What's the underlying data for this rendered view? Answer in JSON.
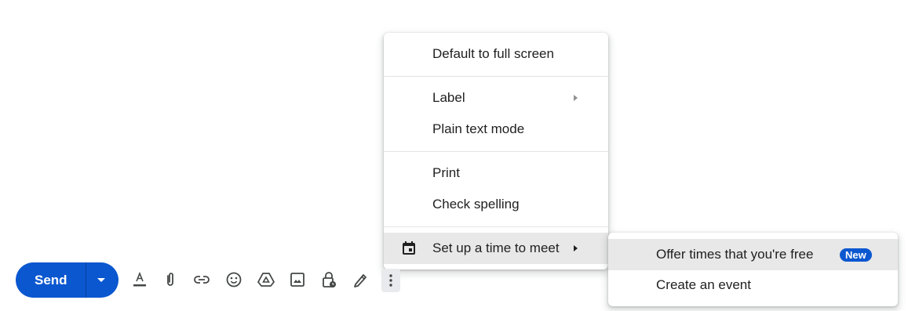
{
  "main_menu": {
    "items": [
      {
        "label": "Default to full screen"
      },
      {
        "label": "Label"
      },
      {
        "label": "Plain text mode"
      },
      {
        "label": "Print"
      },
      {
        "label": "Check spelling"
      },
      {
        "label": "Set up a time to meet"
      }
    ]
  },
  "submenu": {
    "items": [
      {
        "label": "Offer times that you're free",
        "badge": "New"
      },
      {
        "label": "Create an event"
      }
    ]
  },
  "toolbar": {
    "send_label": "Send",
    "icons": [
      "format-text-icon",
      "attach-icon",
      "link-icon",
      "emoji-icon",
      "drive-icon",
      "photo-icon",
      "confidential-lock-icon",
      "signature-icon",
      "more-options-icon"
    ]
  },
  "colors": {
    "primary": "#0b57d0",
    "highlight": "#e8e8e8",
    "icon": "#444746"
  }
}
